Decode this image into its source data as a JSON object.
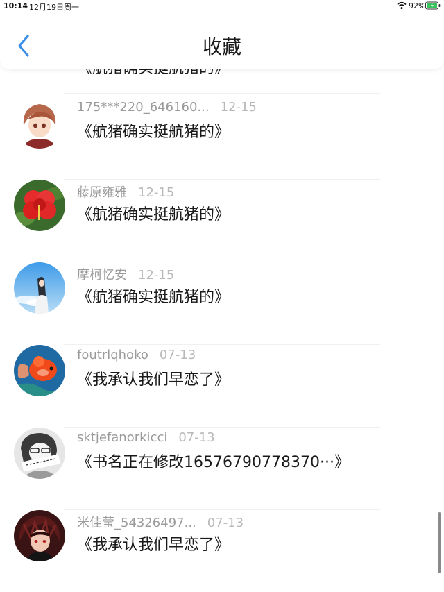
{
  "status_bar": {
    "time": "10:14",
    "date": "12月19日周一",
    "battery_percent": "92%"
  },
  "nav": {
    "title": "收藏",
    "accent_color": "#3a8ee6"
  },
  "list": {
    "items": [
      {
        "author": "",
        "date": "",
        "title": "《航猪确实挺航猪的》",
        "avatar": "partial-avatar"
      },
      {
        "author": "175***220_646160...",
        "date": "12-15",
        "title": "《航猪确实挺航猪的》",
        "avatar": "anime-boy-avatar"
      },
      {
        "author": "藤原雍雅",
        "date": "12-15",
        "title": "《航猪确实挺航猪的》",
        "avatar": "red-flower-avatar"
      },
      {
        "author": "摩柯忆安",
        "date": "12-15",
        "title": "《航猪确实挺航猪的》",
        "avatar": "sky-girl-avatar"
      },
      {
        "author": "foutrlqhoko",
        "date": "07-13",
        "title": "《我承认我们早恋了》",
        "avatar": "goldfish-avatar"
      },
      {
        "author": "sktjefanorkicci",
        "date": "07-13",
        "title": "《书名正在修改16576790778370···》",
        "avatar": "sketch-avatar"
      },
      {
        "author": "米佳莹_54326497...",
        "date": "07-13",
        "title": "《我承认我们早恋了》",
        "avatar": "dark-anime-avatar"
      }
    ]
  }
}
